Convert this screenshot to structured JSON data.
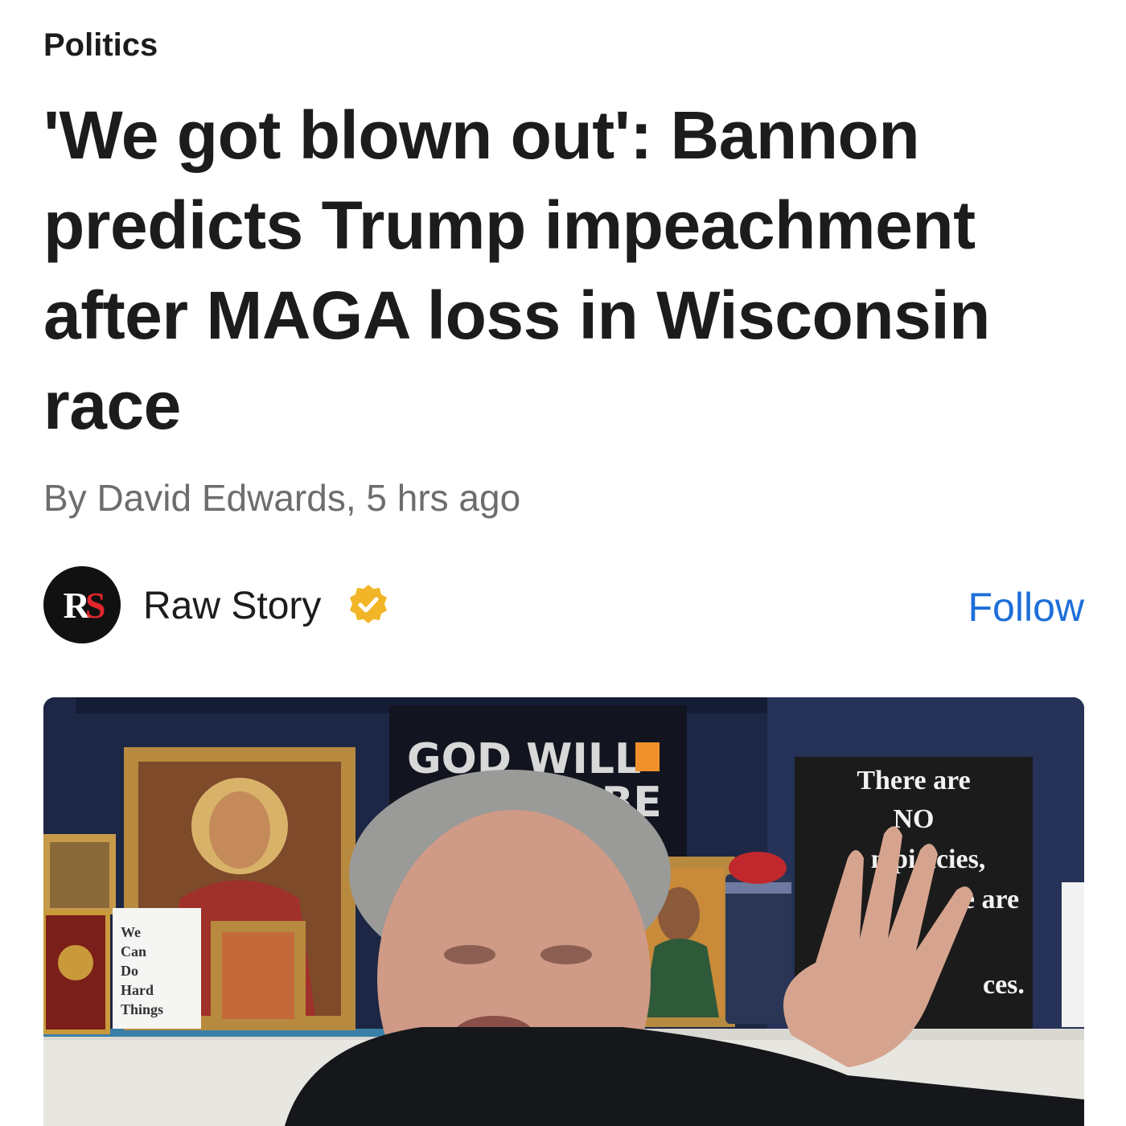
{
  "article": {
    "category": "Politics",
    "headline": "'We got blown out': Bannon predicts Trump impeachment after MAGA loss in Wisconsin race",
    "byline_author": "By David Edwards",
    "byline_time": "5 hrs ago"
  },
  "source": {
    "logo_text_1": "R",
    "logo_text_2": "S",
    "name": "Raw Story",
    "verified_icon": "verified-badge-icon",
    "follow_label": "Follow"
  },
  "photo": {
    "sign_left_line1": "GOD WILL",
    "sign_left_line2": "T BE",
    "sign_right_line1": "There are",
    "sign_right_line2": "NO",
    "sign_right_line3": "n  pi  acies,",
    "sign_right_line4": "e are",
    "sign_right_line5": "c",
    "sign_right_line6": "ces.",
    "card_line1": "We",
    "card_line2": "Can",
    "card_line3": "Do",
    "card_line4": "Hard",
    "card_line5": "Things"
  },
  "colors": {
    "accent_link": "#1e6fd9",
    "verified_gold": "#f2b527",
    "logo_red": "#e3262b"
  }
}
